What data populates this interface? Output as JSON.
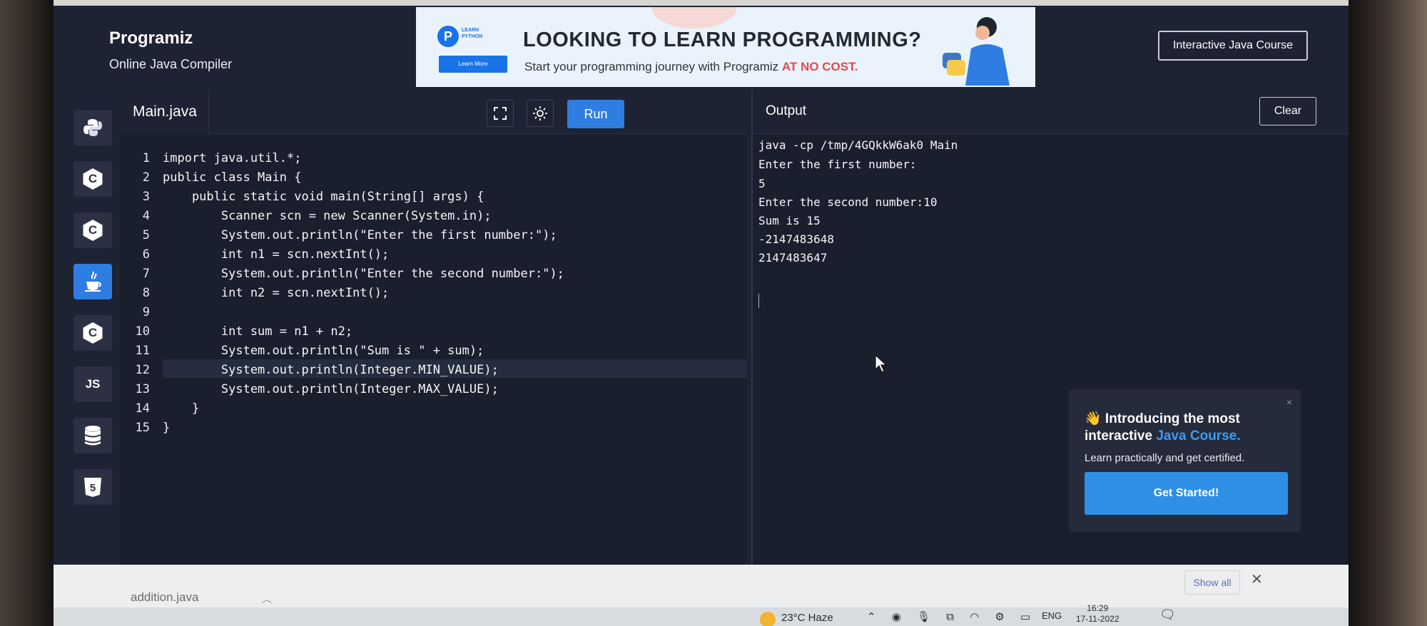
{
  "header": {
    "logo_text": "Programiz",
    "subtitle": "Online Java Compiler",
    "course_button": "Interactive Java Course"
  },
  "ad": {
    "badge_letter": "P",
    "badge_text": "LEARN PYTHON",
    "learn_more": "Learn More",
    "title": "LOOKING TO LEARN PROGRAMMING?",
    "subtitle_prefix": "Start your programming journey with Programiz ",
    "subtitle_accent": "AT NO COST."
  },
  "sidebar": {
    "items": [
      {
        "name": "python",
        "label": ""
      },
      {
        "name": "c",
        "label": "C"
      },
      {
        "name": "cpp",
        "label": "C"
      },
      {
        "name": "java",
        "label": "",
        "active": true
      },
      {
        "name": "csharp",
        "label": "C"
      },
      {
        "name": "javascript",
        "label": "JS"
      },
      {
        "name": "sql",
        "label": ""
      },
      {
        "name": "html",
        "label": "5"
      }
    ]
  },
  "editor": {
    "file_name": "Main.java",
    "run_label": "Run",
    "line_numbers": [
      "1",
      "2",
      "3",
      "4",
      "5",
      "6",
      "7",
      "8",
      "9",
      "10",
      "11",
      "12",
      "13",
      "14",
      "15"
    ],
    "lines": [
      "import java.util.*;",
      "public class Main {",
      "    public static void main(String[] args) {",
      "        Scanner scn = new Scanner(System.in);",
      "        System.out.println(\"Enter the first number:\");",
      "        int n1 = scn.nextInt();",
      "        System.out.println(\"Enter the second number:\");",
      "        int n2 = scn.nextInt();",
      "",
      "        int sum = n1 + n2;",
      "        System.out.println(\"Sum is \" + sum);",
      "        System.out.println(Integer.MIN_VALUE);",
      "        System.out.println(Integer.MAX_VALUE);",
      "    }",
      "}"
    ]
  },
  "output": {
    "title": "Output",
    "clear_label": "Clear",
    "lines": [
      "java -cp /tmp/4GQkkW6ak0 Main",
      "Enter the first number:",
      "5",
      "Enter the second number:10",
      "Sum is 15",
      "-2147483648",
      "2147483647"
    ]
  },
  "promo": {
    "close": "×",
    "title_prefix": "👋 Introducing the most interactive ",
    "title_accent": "Java Course.",
    "subtitle": "Learn practically and get certified.",
    "button": "Get Started!"
  },
  "downloads": {
    "file": "addition.java",
    "show_all": "Show all",
    "close": "✕"
  },
  "taskbar": {
    "weather": "23°C  Haze",
    "tray_icons": "⌃ ◉ 🎙 ⧉ ◠ ⚙ ▭",
    "language": "ENG",
    "time": "16:29",
    "date": "17-11-2022",
    "notification": "🗨"
  }
}
